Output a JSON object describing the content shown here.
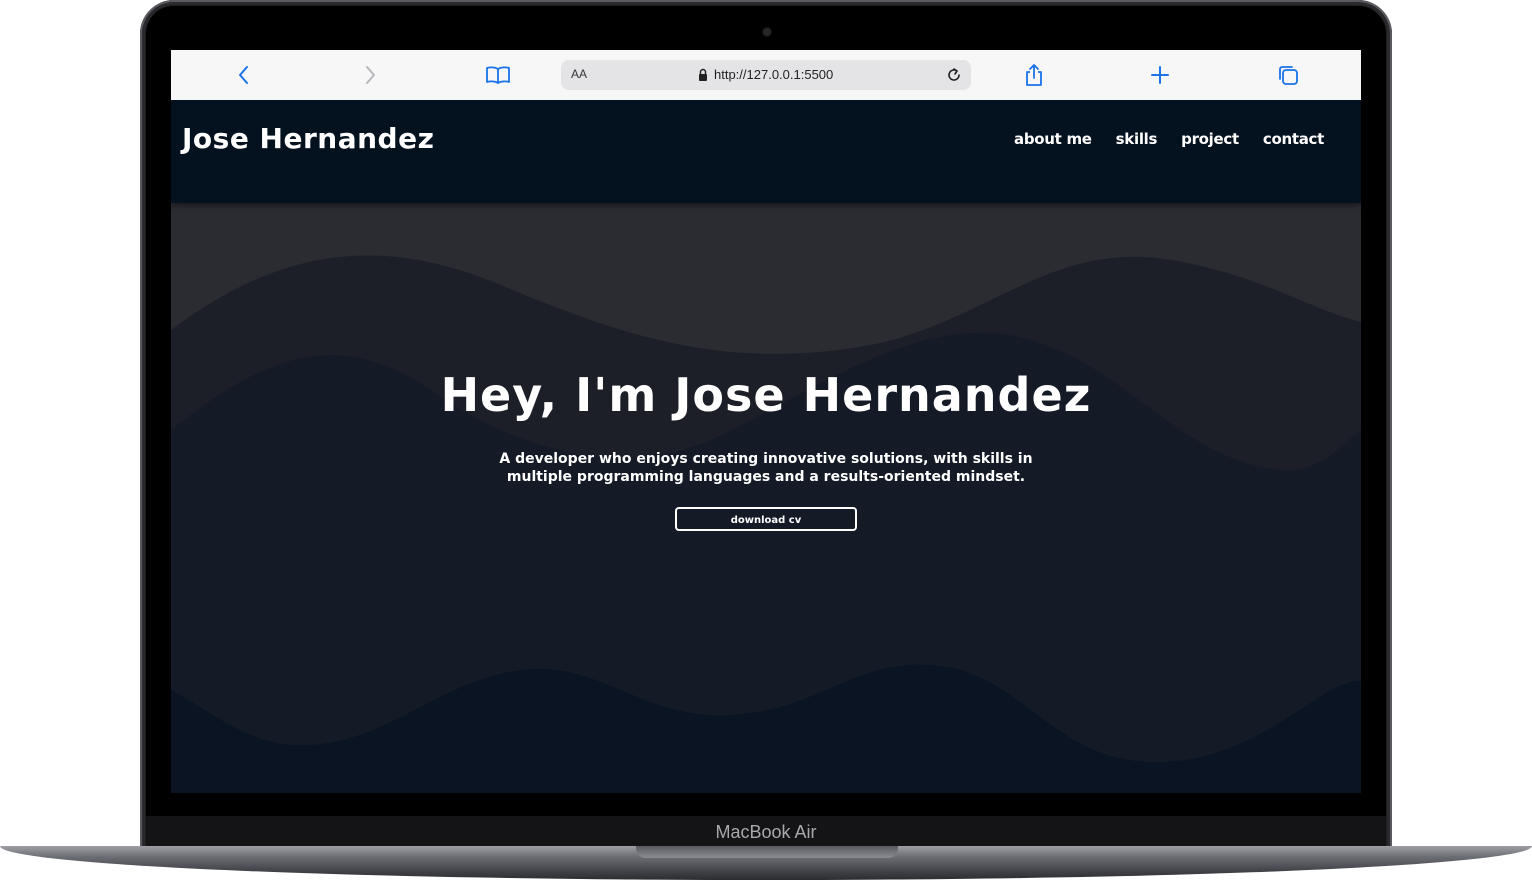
{
  "device": {
    "label": "MacBook Air"
  },
  "browser": {
    "address": {
      "text_size_label": "AA",
      "url": "http://127.0.0.1:5500"
    },
    "icons": {
      "back": "chevron-left-icon",
      "forward": "chevron-right-icon",
      "bookmarks": "book-icon",
      "lock": "lock-icon",
      "reload": "reload-icon",
      "share": "share-icon",
      "new_tab": "plus-icon",
      "tabs": "tabs-icon"
    },
    "accent_color": "#1a73e8"
  },
  "site": {
    "logo": "Jose Hernandez",
    "nav": [
      {
        "label": "about me"
      },
      {
        "label": "skills"
      },
      {
        "label": "project"
      },
      {
        "label": "contact"
      }
    ],
    "hero": {
      "title": "Hey, I'm Jose Hernandez",
      "subtitle": "A developer who enjoys creating innovative solutions, with skills in multiple programming languages and a results-oriented mindset.",
      "button_label": "download cv"
    },
    "colors": {
      "navbar": "#04111f",
      "text": "#ffffff"
    }
  }
}
